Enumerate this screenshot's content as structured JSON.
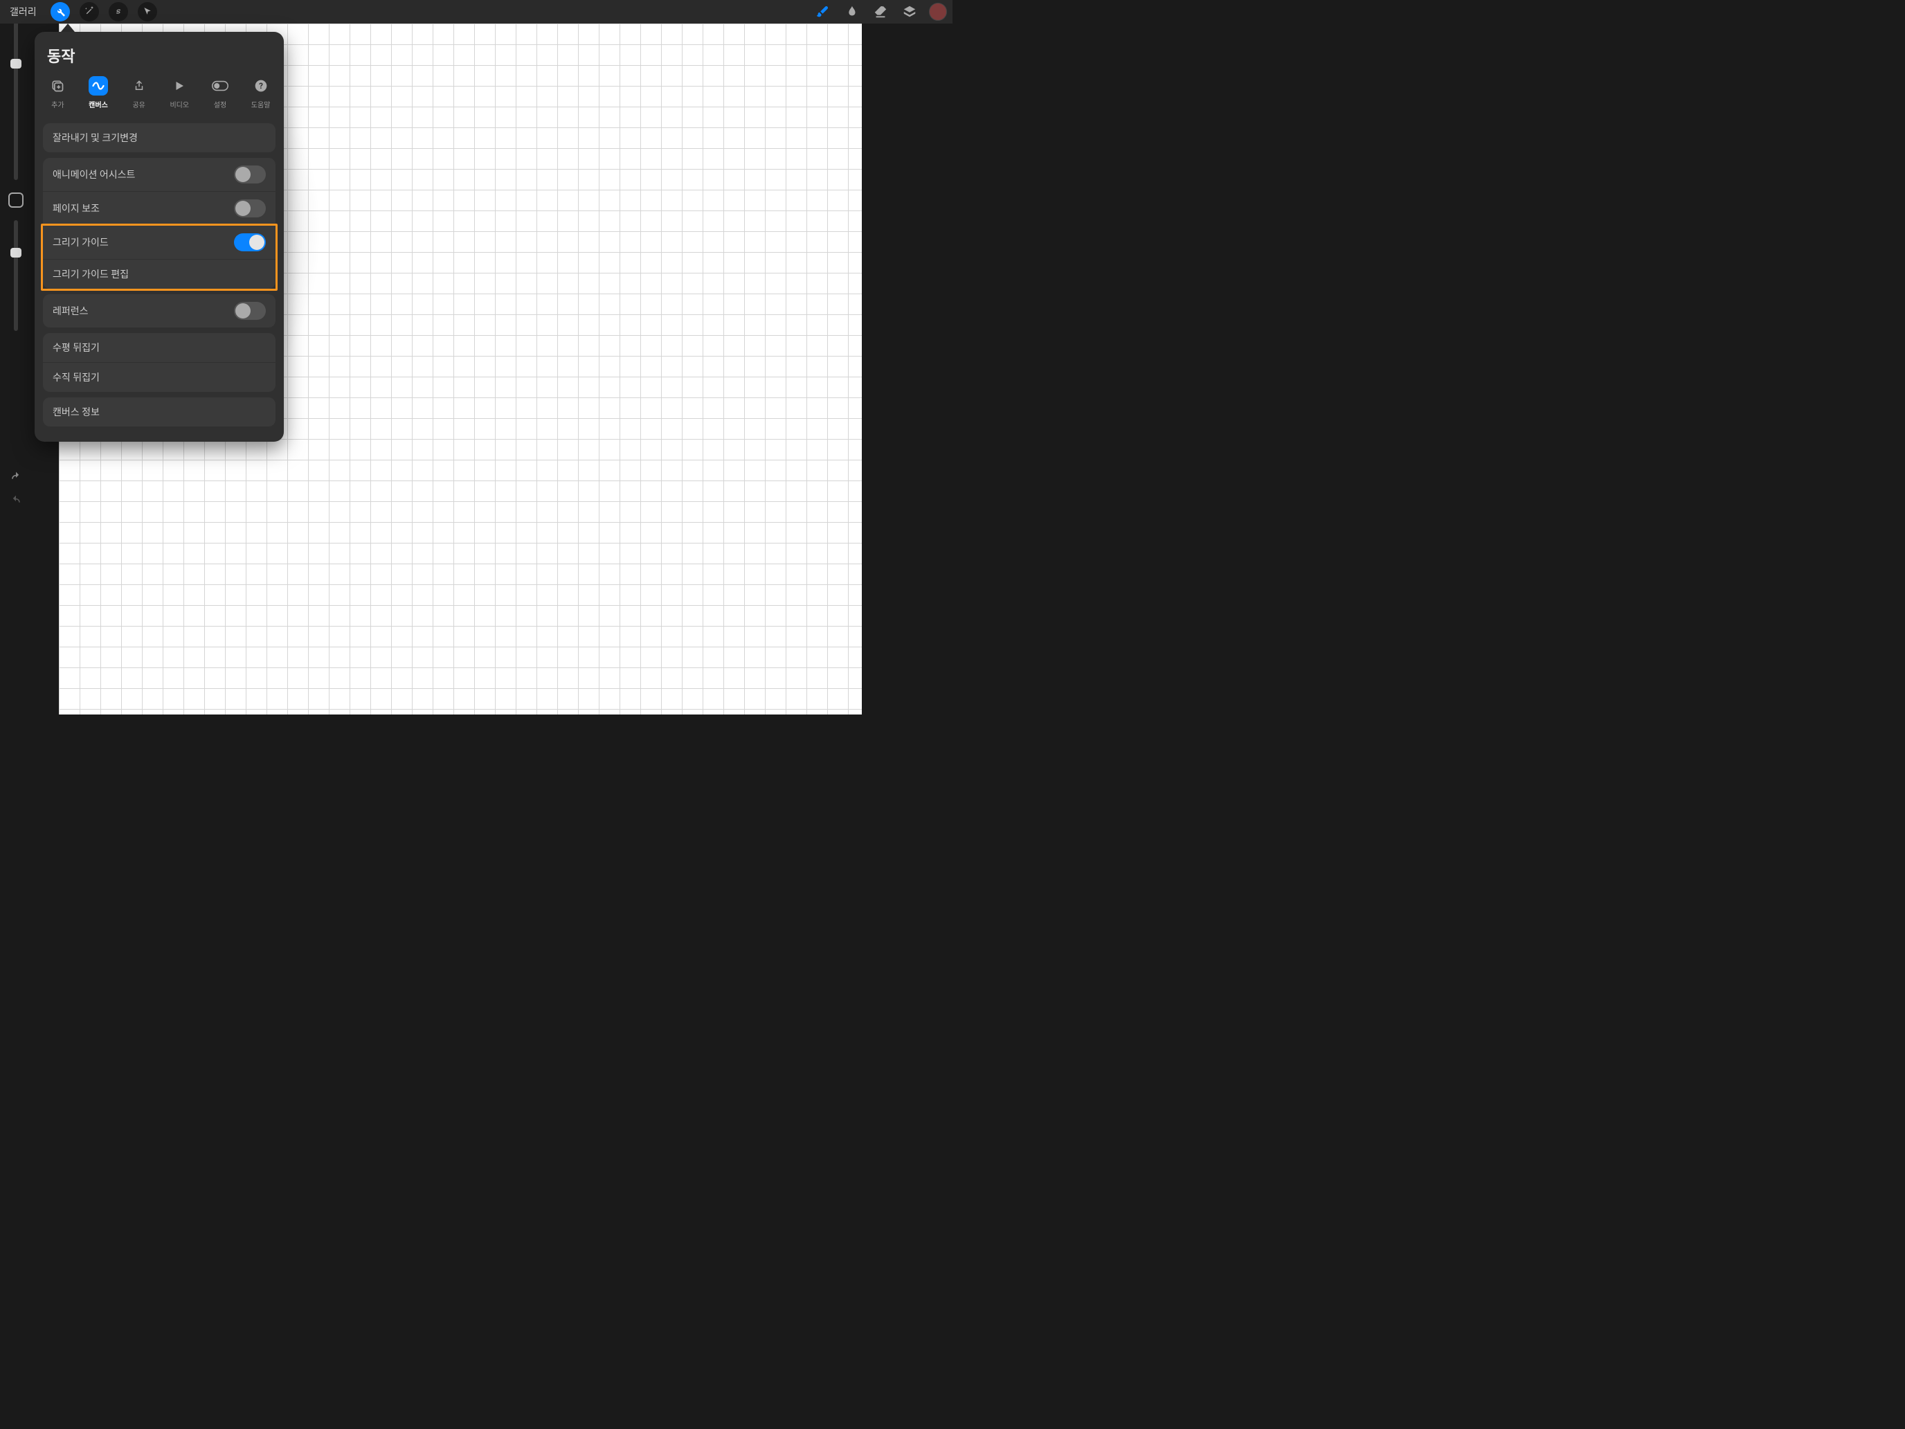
{
  "topbar": {
    "gallery": "갤러리"
  },
  "panel": {
    "title": "동작",
    "tabs": [
      {
        "label": "추가",
        "icon": "add"
      },
      {
        "label": "캔버스",
        "icon": "canvas"
      },
      {
        "label": "공유",
        "icon": "share"
      },
      {
        "label": "비디오",
        "icon": "video"
      },
      {
        "label": "설정",
        "icon": "prefs"
      },
      {
        "label": "도움말",
        "icon": "help"
      }
    ],
    "active_tab_index": 1,
    "rows": {
      "crop": "잘라내기 및 크기변경",
      "anim": "애니메이션 어시스트",
      "page_assist": "페이지 보조",
      "draw_guide": "그리기 가이드",
      "edit_guide": "그리기 가이드 편집",
      "reference": "레퍼런스",
      "flip_h": "수평 뒤집기",
      "flip_v": "수직 뒤집기",
      "canvas_info": "캔버스 정보"
    },
    "toggles": {
      "anim": false,
      "page_assist": false,
      "draw_guide": true,
      "reference": false
    }
  },
  "highlight": {
    "target": "drawing-guide-rows"
  }
}
